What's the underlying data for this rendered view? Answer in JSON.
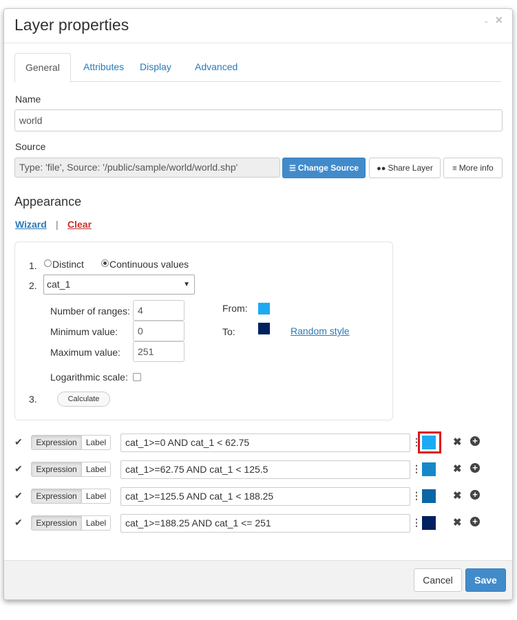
{
  "dialog": {
    "title": "Layer properties",
    "minimize_label": "-",
    "close_label": "×"
  },
  "tabs": [
    {
      "label": "General",
      "active": true
    },
    {
      "label": "Attributes"
    },
    {
      "label": "Display"
    },
    {
      "label": "Advanced"
    }
  ],
  "name_field": {
    "label": "Name",
    "value": "world"
  },
  "source_field": {
    "label": "Source",
    "value": "Type: 'file', Source: '/public/sample/world/world.shp'",
    "change_source_label": "Change Source",
    "share_layer_label": "Share Layer",
    "more_info_label": "More info"
  },
  "appearance": {
    "title": "Appearance",
    "wizard_link": "Wizard",
    "separator": "|",
    "clear_link": "Clear",
    "step1_num": "1.",
    "distinct_label": "Distinct",
    "continuous_label": "Continuous values",
    "mode_selected": "Continuous values",
    "step2_num": "2.",
    "attribute_selected": "cat_1",
    "caret": "▼",
    "num_ranges_label": "Number of ranges:",
    "num_ranges_value": "4",
    "min_label": "Minimum value:",
    "min_value": "0",
    "max_label": "Maximum value:",
    "max_value": "251",
    "from_label": "From:",
    "from_color": "#1eaaf1",
    "to_label": "To:",
    "to_color": "#002060",
    "random_style_link": "Random style",
    "log_scale_label": "Logarithmic scale:",
    "log_scale_checked": false,
    "step3_num": "3.",
    "calculate_label": "Calculate"
  },
  "rules": [
    {
      "expression_label": "Expression",
      "label_label": "Label",
      "value": "cat_1>=0 AND cat_1 < 62.75",
      "color": "#1eaaf1",
      "highlighted": true
    },
    {
      "expression_label": "Expression",
      "label_label": "Label",
      "value": "cat_1>=62.75 AND cat_1 < 125.5",
      "color": "#1588cb",
      "highlighted": false
    },
    {
      "expression_label": "Expression",
      "label_label": "Label",
      "value": "cat_1>=125.5 AND cat_1 < 188.25",
      "color": "#0b66a6",
      "highlighted": false
    },
    {
      "expression_label": "Expression",
      "label_label": "Label",
      "value": "cat_1>=188.25 AND cat_1 <= 251",
      "color": "#002060",
      "highlighted": false
    }
  ],
  "footer": {
    "cancel_label": "Cancel",
    "save_label": "Save"
  }
}
